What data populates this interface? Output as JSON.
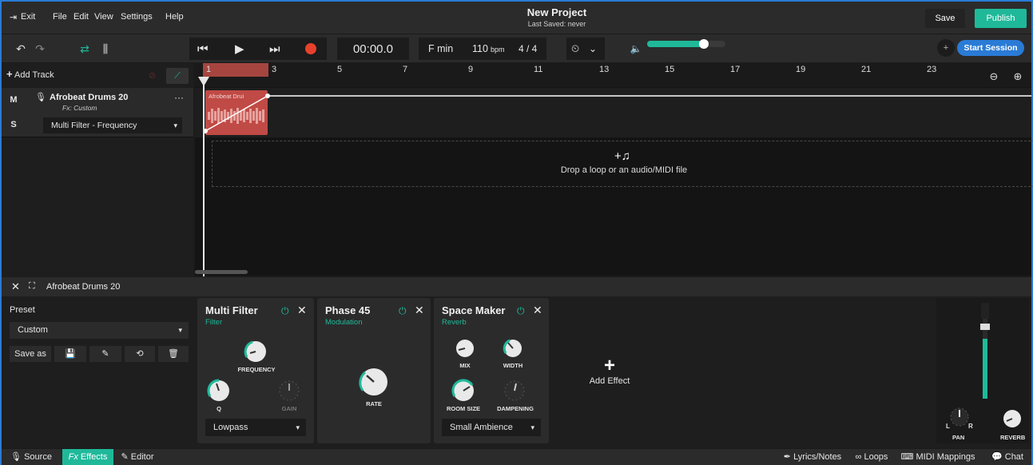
{
  "menubar": {
    "exit_label": "Exit",
    "file_label": "File",
    "edit_label": "Edit",
    "view_label": "View",
    "settings_label": "Settings",
    "help_label": "Help",
    "project_title": "New Project",
    "last_saved": "Last Saved: never",
    "save_label": "Save",
    "publish_label": "Publish"
  },
  "toolbar": {
    "time": "00:00.0",
    "key": "F min",
    "bpm_value": "110",
    "bpm_unit": "bpm",
    "time_signature": "4 / 4",
    "volume_level": 0.7,
    "start_session_label": "Start Session"
  },
  "tracks": {
    "add_track_label": "Add Track",
    "track": {
      "mute_label": "M",
      "solo_label": "S",
      "name": "Afrobeat Drums 20",
      "fx_label": "Fx: Custom",
      "automation_param": "Multi Filter - Frequency",
      "more_label": "···"
    }
  },
  "timeline": {
    "bars": [
      "1",
      "3",
      "5",
      "7",
      "9",
      "11",
      "13",
      "15",
      "17",
      "19",
      "21",
      "23"
    ],
    "clip_label": "Afrobeat Drui",
    "drop_text": "Drop a loop or an audio/MIDI file",
    "drop_icon": "+♫"
  },
  "effects_panel": {
    "track_name": "Afrobeat Drums 20",
    "preset_label": "Preset",
    "preset_value": "Custom",
    "save_as_label": "Save as",
    "effects": [
      {
        "name": "Multi Filter",
        "category": "Filter",
        "knobs": [
          "FREQUENCY",
          "Q",
          "GAIN"
        ],
        "select": "Lowpass"
      },
      {
        "name": "Phase 45",
        "category": "Modulation",
        "knobs": [
          "RATE"
        ]
      },
      {
        "name": "Space Maker",
        "category": "Reverb",
        "knobs": [
          "MIX",
          "WIDTH",
          "ROOM SIZE",
          "DAMPENING"
        ],
        "select": "Small Ambience"
      }
    ],
    "add_effect_label": "Add Effect",
    "pan_label": "PAN",
    "reverb_label": "REVERB",
    "pan_left": "L",
    "pan_right": "R"
  },
  "bottombar": {
    "source_label": "Source",
    "fx_prefix": "Fx",
    "effects_label": "Effects",
    "editor_label": "Editor",
    "lyrics_label": "Lyrics/Notes",
    "loops_label": "Loops",
    "midi_label": "MIDI Mappings",
    "chat_label": "Chat"
  },
  "colors": {
    "accent": "#1fb99a",
    "session_blue": "#2a7bd6",
    "record": "#e8412b",
    "clip": "#c04a45"
  }
}
